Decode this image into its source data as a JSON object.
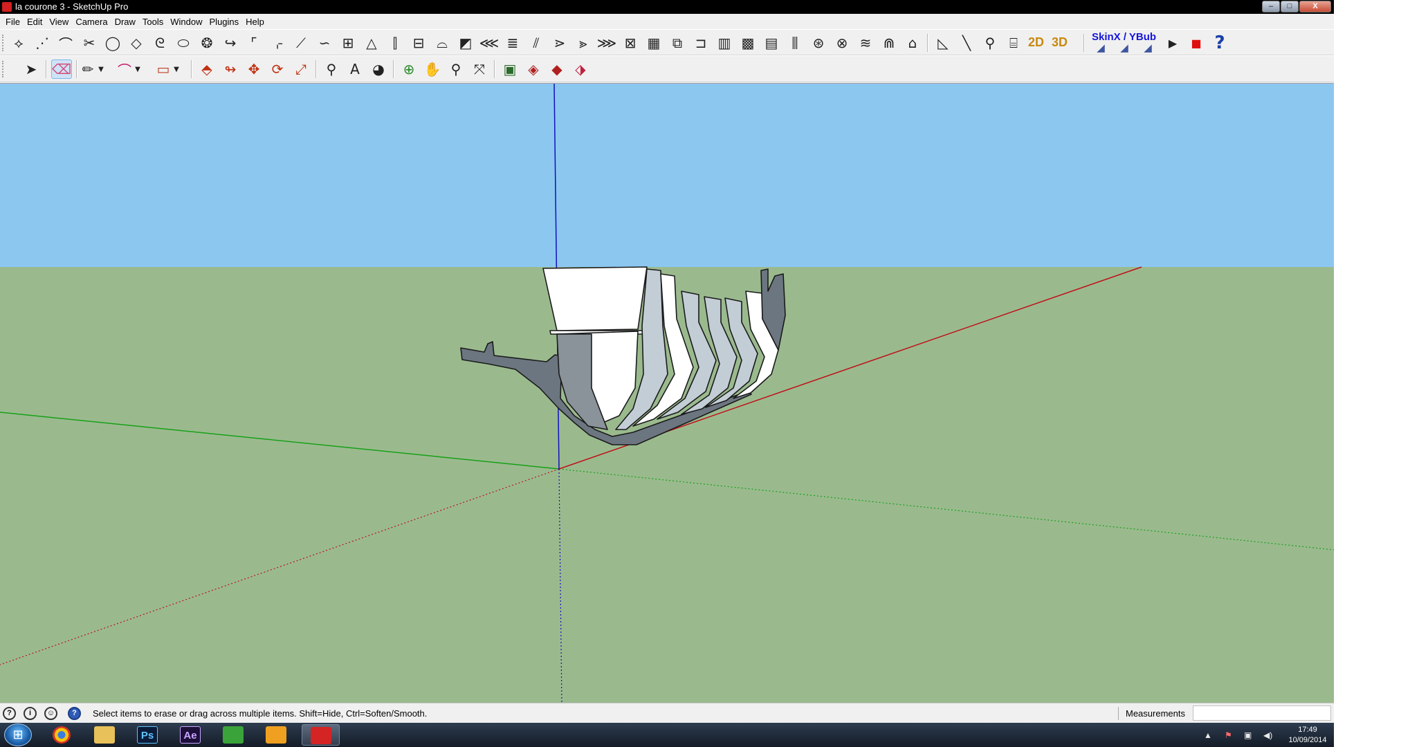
{
  "window": {
    "title": "la courone 3 - SketchUp Pro",
    "minimize_label": "–",
    "maximize_label": "□",
    "close_label": "X"
  },
  "menu": [
    "File",
    "Edit",
    "View",
    "Camera",
    "Draw",
    "Tools",
    "Window",
    "Plugins",
    "Help"
  ],
  "toolbar_top": {
    "view_2d_label": "2D",
    "view_3d_label": "3D",
    "plugin_label": "SkinX / YBub"
  },
  "toolbar_main": {
    "selected_tool": "eraser"
  },
  "viewport": {
    "sky_color": "#8cc7f0",
    "ground_color": "#9aba8e",
    "red_axis_color": "#c0101a",
    "green_axis_color": "#16a016",
    "blue_axis_color": "#1010c0",
    "model": "ship hull frames"
  },
  "status": {
    "message": "Select items to erase or drag across multiple items. Shift=Hide, Ctrl=Soften/Smooth.",
    "measurements_label": "Measurements",
    "measurements_value": ""
  },
  "taskbar": {
    "apps": [
      {
        "name": "chrome",
        "label": ""
      },
      {
        "name": "explorer",
        "label": ""
      },
      {
        "name": "photoshop",
        "label": "Ps"
      },
      {
        "name": "after-effects",
        "label": "Ae"
      },
      {
        "name": "app-green",
        "label": ""
      },
      {
        "name": "media-player",
        "label": ""
      },
      {
        "name": "sketchup",
        "label": ""
      }
    ],
    "time": "17:49",
    "date": "10/09/2014"
  }
}
